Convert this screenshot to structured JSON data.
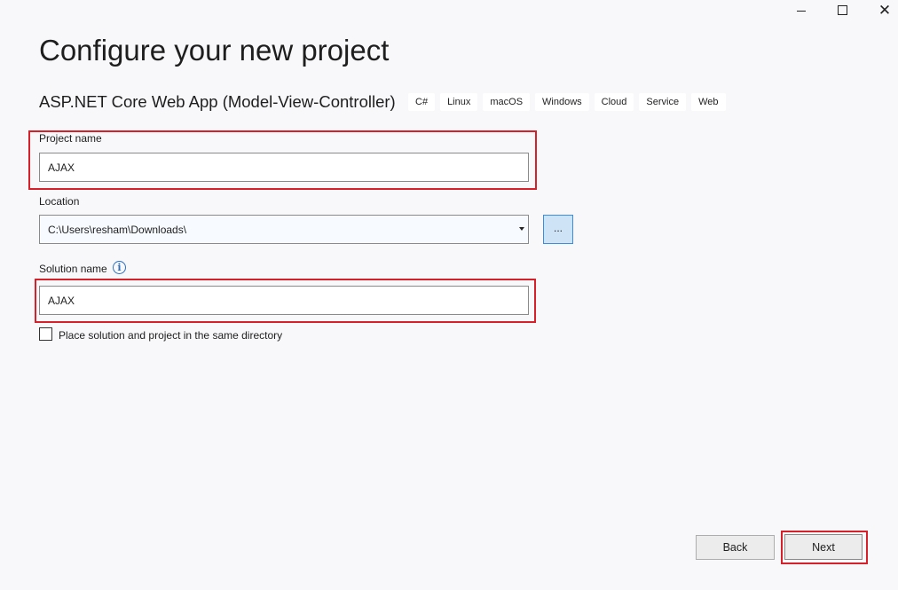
{
  "window_controls": {
    "close_glyph": "✕"
  },
  "header": {
    "title": "Configure your new project",
    "template_name": "ASP.NET Core Web App (Model-View-Controller)",
    "tags": [
      "C#",
      "Linux",
      "macOS",
      "Windows",
      "Cloud",
      "Service",
      "Web"
    ]
  },
  "form": {
    "project_name_label": "Project name",
    "project_name_value": "AJAX",
    "location_label": "Location",
    "location_value": "C:\\Users\\resham\\Downloads\\",
    "browse_label": "...",
    "solution_name_label": "Solution name",
    "info_icon_glyph": "i",
    "solution_name_value": "AJAX",
    "same_dir_label": "Place solution and project in the same directory",
    "same_dir_checked": false
  },
  "footer": {
    "back_label": "Back",
    "next_label": "Next"
  },
  "colors": {
    "highlight": "#d6212b",
    "background": "#f8f8fb",
    "browse_button": "#cfe3f7"
  }
}
